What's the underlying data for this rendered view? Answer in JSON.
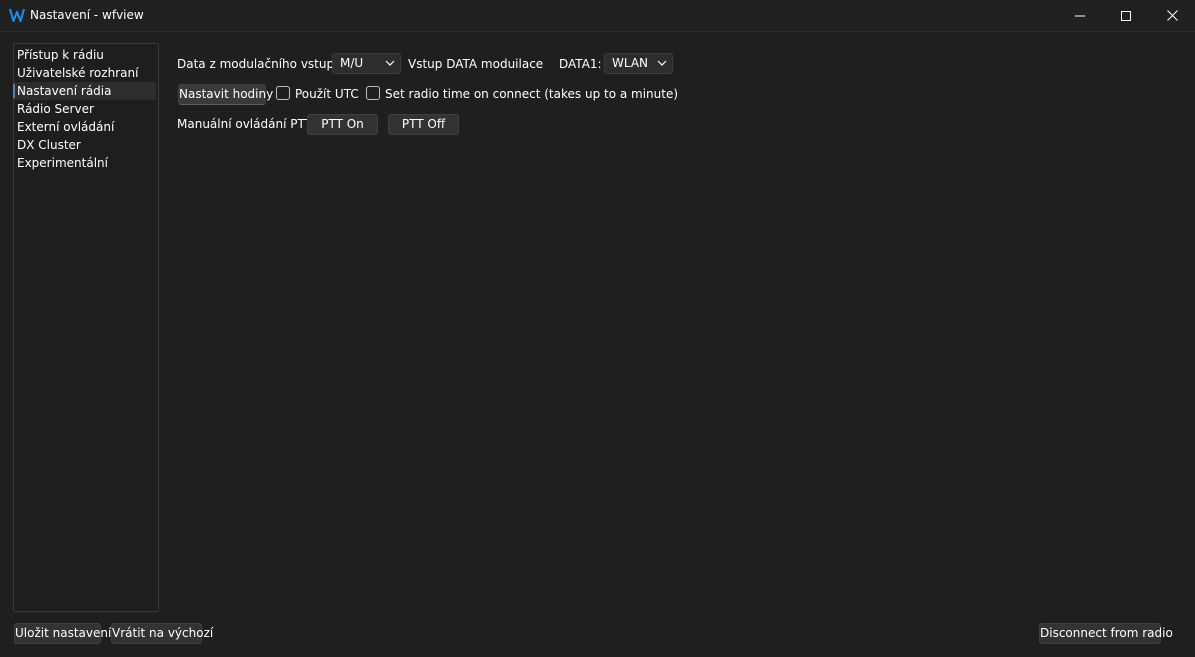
{
  "window": {
    "title": "Nastavení - wfview",
    "logo_icon": "wfview-logo-icon",
    "accent_color": "#1e88e5"
  },
  "sidebar": {
    "items": [
      {
        "label": "Přístup k rádiu",
        "selected": false
      },
      {
        "label": "Uživatelské rozhraní",
        "selected": false
      },
      {
        "label": "Nastavení rádia",
        "selected": true
      },
      {
        "label": "Rádio Server",
        "selected": false
      },
      {
        "label": "Externí ovládání",
        "selected": false
      },
      {
        "label": "DX Cluster",
        "selected": false
      },
      {
        "label": "Experimentální",
        "selected": false
      }
    ]
  },
  "radio_settings": {
    "mod_input_label": "Data z modulačního vstupu:",
    "mod_input_value": "M/U",
    "data_mod_label": "Vstup DATA moduilace",
    "data1_label": "DATA1:",
    "data1_value": "WLAN",
    "set_clock_button": "Nastavit hodiny",
    "use_utc_label": "Použít UTC",
    "use_utc_checked": false,
    "set_time_label": "Set radio time on connect (takes up to a minute)",
    "set_time_checked": false,
    "ptt_label": "Manuální ovládání PTT",
    "ptt_on_button": "PTT On",
    "ptt_off_button": "PTT Off"
  },
  "footer": {
    "save_button": "Uložit nastavení",
    "reset_button": "Vrátit na výchozí",
    "disconnect_button": "Disconnect from radio"
  }
}
